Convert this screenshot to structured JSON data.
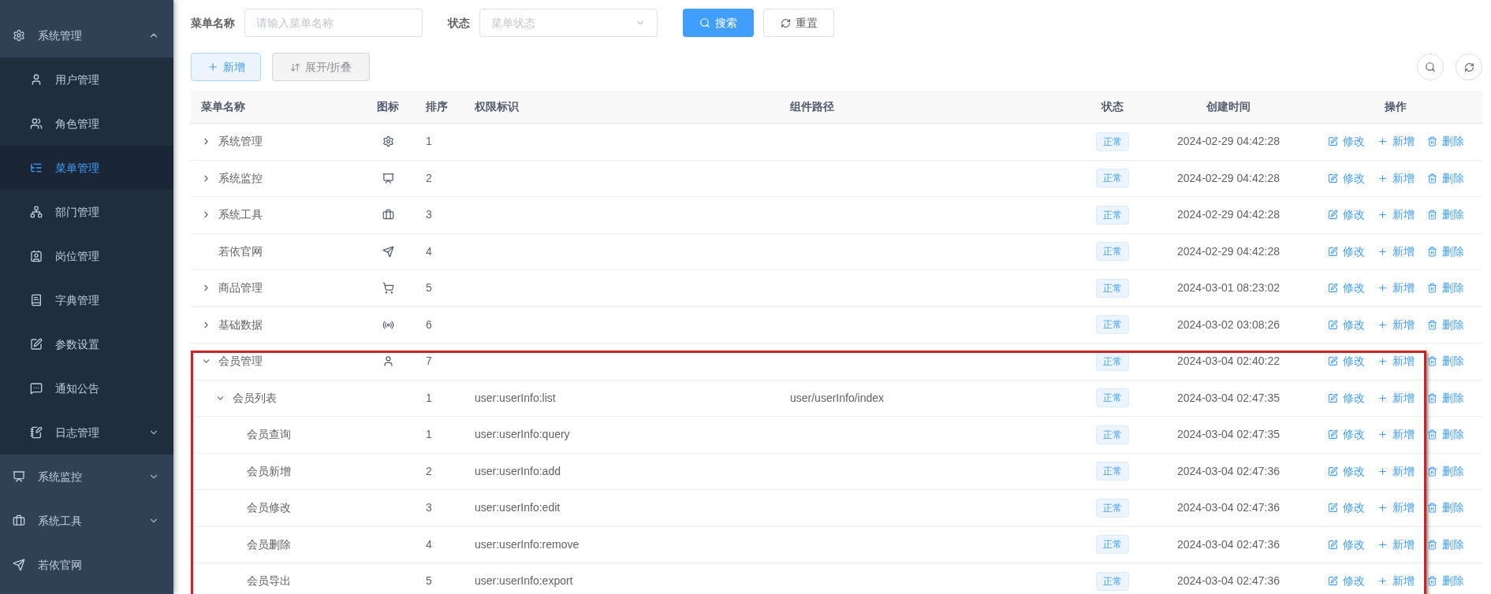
{
  "sidebar": {
    "items": [
      {
        "label": "系统管理",
        "selected": false,
        "expanded": true,
        "children": [
          {
            "label": "用户管理",
            "selected": false
          },
          {
            "label": "角色管理",
            "selected": false
          },
          {
            "label": "菜单管理",
            "selected": true
          },
          {
            "label": "部门管理",
            "selected": false
          },
          {
            "label": "岗位管理",
            "selected": false
          },
          {
            "label": "字典管理",
            "selected": false
          },
          {
            "label": "参数设置",
            "selected": false
          },
          {
            "label": "通知公告",
            "selected": false
          },
          {
            "label": "日志管理",
            "selected": false,
            "expanded": false
          }
        ]
      },
      {
        "label": "系统监控",
        "selected": false,
        "expanded": false
      },
      {
        "label": "系统工具",
        "selected": false,
        "expanded": false
      },
      {
        "label": "若依官网",
        "selected": false
      }
    ]
  },
  "filters": [
    {
      "label": "菜单名称",
      "kind": "input",
      "placeholder": "请输入菜单名称"
    },
    {
      "label": "状态",
      "kind": "select",
      "placeholder": "菜单状态"
    }
  ],
  "filter_buttons": [
    {
      "label": "搜索",
      "kind": "primary"
    },
    {
      "label": "重置",
      "kind": "default"
    }
  ],
  "toolbar": [
    {
      "label": "新增",
      "kind": "add"
    },
    {
      "label": "展开/折叠",
      "kind": "toggle"
    }
  ],
  "table": {
    "columns": [
      "菜单名称",
      "图标",
      "排序",
      "权限标识",
      "组件路径",
      "状态",
      "创建时间",
      "操作"
    ],
    "rows": [
      {
        "name": "系统管理",
        "expanded": false,
        "sort": "1",
        "status": "正常",
        "time": "2024-02-29 04:42:28",
        "actions": [
          "修改",
          "新增",
          "删除"
        ]
      },
      {
        "name": "系统监控",
        "expanded": false,
        "sort": "2",
        "status": "正常",
        "time": "2024-02-29 04:42:28",
        "actions": [
          "修改",
          "新增",
          "删除"
        ]
      },
      {
        "name": "系统工具",
        "expanded": false,
        "sort": "3",
        "status": "正常",
        "time": "2024-02-29 04:42:28",
        "actions": [
          "修改",
          "新增",
          "删除"
        ]
      },
      {
        "name": "若依官网",
        "sort": "4",
        "status": "正常",
        "time": "2024-02-29 04:42:28",
        "actions": [
          "修改",
          "新增",
          "删除"
        ]
      },
      {
        "name": "商品管理",
        "expanded": false,
        "sort": "5",
        "status": "正常",
        "time": "2024-03-01 08:23:02",
        "actions": [
          "修改",
          "新增",
          "删除"
        ]
      },
      {
        "name": "基础数据",
        "expanded": false,
        "sort": "6",
        "status": "正常",
        "time": "2024-03-02 03:08:26",
        "actions": [
          "修改",
          "新增",
          "删除"
        ]
      },
      {
        "name": "会员管理",
        "expanded": true,
        "highlighted": true,
        "sort": "7",
        "status": "正常",
        "time": "2024-03-04 02:40:22",
        "actions": [
          "修改",
          "新增",
          "删除"
        ],
        "children": [
          {
            "name": "会员列表",
            "expanded": true,
            "sort": "1",
            "perms": "user:userInfo:list",
            "component": "user/userInfo/index",
            "status": "正常",
            "time": "2024-03-04 02:47:35",
            "actions": [
              "修改",
              "新增",
              "删除"
            ],
            "children": [
              {
                "name": "会员查询",
                "sort": "1",
                "perms": "user:userInfo:query",
                "status": "正常",
                "time": "2024-03-04 02:47:35",
                "actions": [
                  "修改",
                  "新增",
                  "删除"
                ]
              },
              {
                "name": "会员新增",
                "sort": "2",
                "perms": "user:userInfo:add",
                "status": "正常",
                "time": "2024-03-04 02:47:36",
                "actions": [
                  "修改",
                  "新增",
                  "删除"
                ]
              },
              {
                "name": "会员修改",
                "sort": "3",
                "perms": "user:userInfo:edit",
                "status": "正常",
                "time": "2024-03-04 02:47:36",
                "actions": [
                  "修改",
                  "新增",
                  "删除"
                ]
              },
              {
                "name": "会员删除",
                "sort": "4",
                "perms": "user:userInfo:remove",
                "status": "正常",
                "time": "2024-03-04 02:47:36",
                "actions": [
                  "修改",
                  "新增",
                  "删除"
                ]
              },
              {
                "name": "会员导出",
                "sort": "5",
                "perms": "user:userInfo:export",
                "status": "正常",
                "time": "2024-03-04 02:47:36",
                "actions": [
                  "修改",
                  "新增",
                  "删除"
                ]
              }
            ]
          }
        ]
      }
    ]
  }
}
